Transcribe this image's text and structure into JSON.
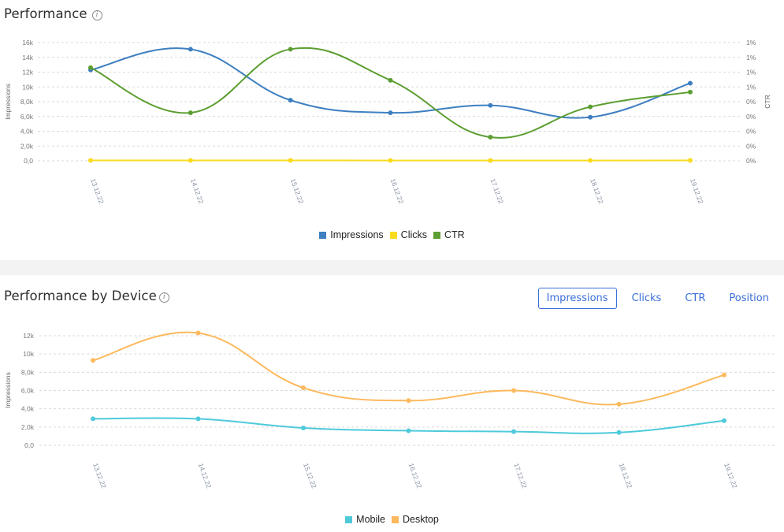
{
  "top_panel": {
    "title": "Performance",
    "info_icon": "info-icon",
    "info_glyph": "i"
  },
  "bottom_panel": {
    "title": "Performance by Device",
    "info_icon": "info-icon",
    "info_glyph": "i",
    "tabs": [
      {
        "label": "Impressions",
        "active": true
      },
      {
        "label": "Clicks",
        "active": false
      },
      {
        "label": "CTR",
        "active": false
      },
      {
        "label": "Position",
        "active": false
      }
    ]
  },
  "chart_data": [
    {
      "type": "line",
      "title": "Performance",
      "categories": [
        "13.12.22",
        "14.12.22",
        "15.12.22",
        "16.12.22",
        "17.12.22",
        "18.12.22",
        "19.12.22"
      ],
      "ylabel": "Impressions",
      "y2label": "CTR",
      "ylim": [
        0,
        16000
      ],
      "y2lim": [
        0,
        1.6
      ],
      "yticks": [
        "0,0",
        "2,0k",
        "4,0k",
        "6,0k",
        "8,0k",
        "10k",
        "12k",
        "14k",
        "16k"
      ],
      "y2ticks": [
        "0%",
        "0%",
        "0%",
        "0%",
        "0%",
        "1%",
        "1%",
        "1%",
        "1%"
      ],
      "grid": true,
      "legend_position": "bottom",
      "series": [
        {
          "name": "Impressions",
          "axis": "left",
          "color": "#3d7fc1",
          "values": [
            12300,
            15100,
            8200,
            6500,
            7500,
            5900,
            10500
          ]
        },
        {
          "name": "Clicks",
          "axis": "left",
          "color": "#fadb1e",
          "values": [
            60,
            50,
            55,
            45,
            35,
            40,
            50
          ]
        },
        {
          "name": "CTR",
          "axis": "right",
          "color": "#5c9e31",
          "values": [
            1.26,
            0.65,
            1.51,
            1.09,
            0.32,
            0.73,
            0.93
          ]
        }
      ]
    },
    {
      "type": "line",
      "title": "Performance by Device",
      "categories": [
        "13.12.22",
        "14.12.22",
        "15.12.22",
        "16.12.22",
        "17.12.22",
        "18.12.22",
        "19.12.22"
      ],
      "ylabel": "Impressions",
      "ylim": [
        0,
        12000
      ],
      "yticks": [
        "0,0",
        "2,0k",
        "4,0k",
        "6,0k",
        "8,0k",
        "10k",
        "12k"
      ],
      "grid": true,
      "legend_position": "bottom",
      "series": [
        {
          "name": "Mobile",
          "color": "#4ecadb",
          "values": [
            2900,
            2900,
            1900,
            1600,
            1500,
            1400,
            2700
          ]
        },
        {
          "name": "Desktop",
          "color": "#fdb95e",
          "values": [
            9300,
            12300,
            6300,
            4900,
            6000,
            4500,
            7700
          ]
        }
      ]
    }
  ]
}
